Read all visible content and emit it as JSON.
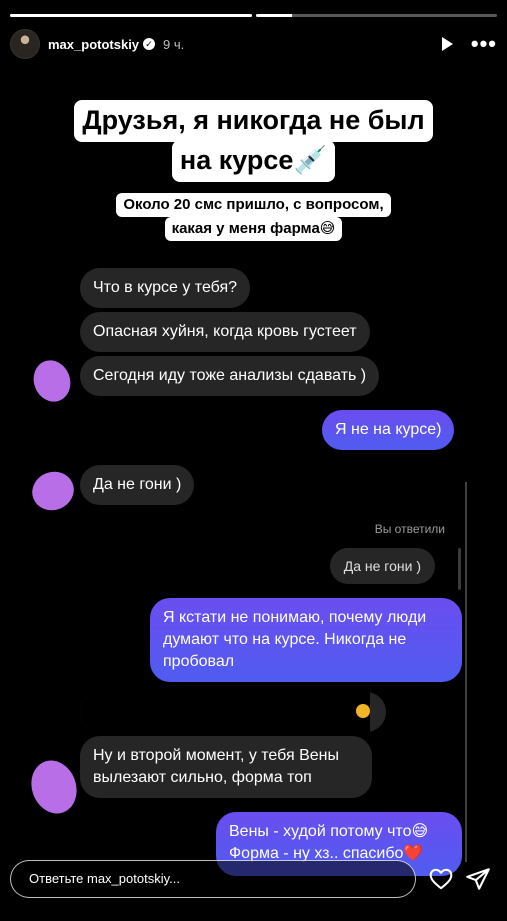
{
  "story": {
    "progress_segments": [
      1,
      0.15
    ],
    "username": "max_pototskiy",
    "verified_mark": "✓",
    "time_ago": "9 ч.",
    "play_icon": "play-icon",
    "more_icon": "more-icon",
    "more_glyph": "•••"
  },
  "caption": {
    "title_line1": "Друзья, я никогда не был",
    "title_line2": "на курсе💉",
    "subtitle_line1": "Около 20 смс пришло, с вопросом,",
    "subtitle_line2": "какая у меня фарма😅"
  },
  "chat": {
    "msg1": "Что в курсе у тебя?",
    "msg2": "Опасная хуйня, когда кровь густеет",
    "msg3": "Сегодня иду тоже анализы сдавать )",
    "msg4": "Я не на курсе)",
    "msg5": "Да не гони )",
    "replied_label": "Вы ответили",
    "reply_quote": "Да не гони )",
    "msg6": "Я кстати не понимаю, почему люди думают что на курсе. Никогда не пробовал",
    "msg7": "Ну и второй момент, у тебя Вены вылезают сильно, форма топ",
    "msg8_line1": "Вены - худой потому что😅",
    "msg8_line2": "Форма - ну хз.. спасибо❤️"
  },
  "footer": {
    "reply_placeholder": "Ответьте max_pototskiy...",
    "heart_icon": "heart-icon",
    "send_icon": "send-icon"
  },
  "colors": {
    "outgoing_bubble": "#5b4dee",
    "incoming_bubble": "#262626",
    "avatar_blob": "#b76ee6"
  }
}
